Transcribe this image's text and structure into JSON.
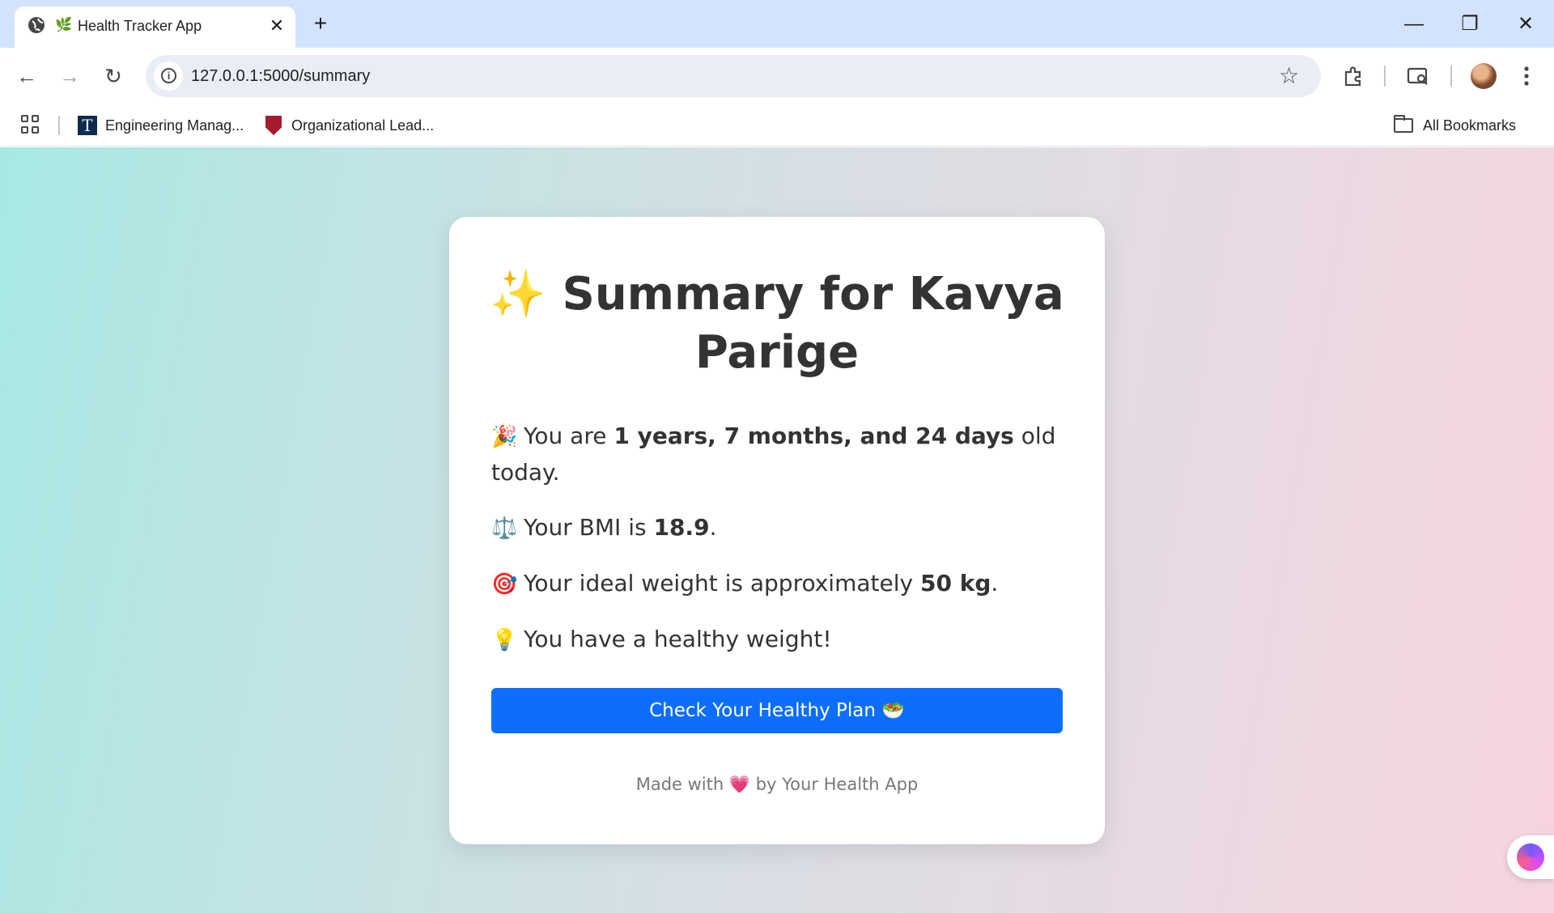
{
  "browser": {
    "tab": {
      "title": "Health Tracker App",
      "favicon": "🌿",
      "close": "✕"
    },
    "new_tab": "+",
    "window": {
      "minimize": "—",
      "restore": "❐",
      "close": "✕"
    },
    "nav": {
      "back": "←",
      "forward": "→",
      "reload": "↻"
    },
    "url": "127.0.0.1:5000/summary",
    "info_icon": "i",
    "bookmark_star": "☆",
    "bookmarks": [
      {
        "label": "Engineering Manag...",
        "icon": "T"
      },
      {
        "label": "Organizational Lead...",
        "icon": "harvard-shield"
      }
    ],
    "all_bookmarks": "All Bookmarks"
  },
  "summary": {
    "title_emoji": "✨",
    "title": "Summary for Kavya Parige",
    "age": {
      "emoji": "🎉",
      "prefix": "You are ",
      "value": "1 years, 7 months, and 24 days",
      "suffix": " old today."
    },
    "bmi": {
      "emoji": "⚖️",
      "prefix": "Your BMI is ",
      "value": "18.9",
      "suffix": "."
    },
    "ideal": {
      "emoji": "🎯",
      "prefix": "Your ideal weight is approximately ",
      "value": "50 kg",
      "suffix": "."
    },
    "status": {
      "emoji": "💡",
      "text": "You have a healthy weight!"
    },
    "button": {
      "label": "Check Your Healthy Plan",
      "emoji": "🥗"
    },
    "footer": {
      "prefix": "Made with ",
      "heart": "💗",
      "suffix": " by Your Health App"
    }
  },
  "colors": {
    "primary": "#0d6efd",
    "tabbar": "#d3e3fd",
    "text": "#333333"
  }
}
